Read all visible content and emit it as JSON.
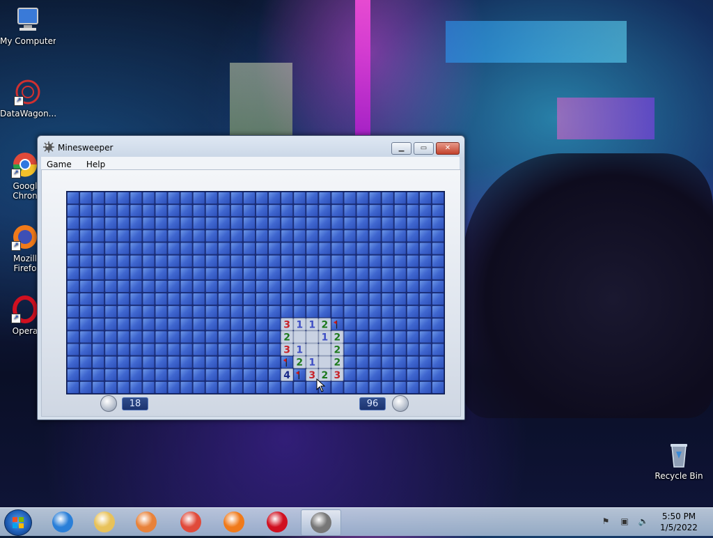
{
  "desktop": {
    "icons": [
      {
        "label": "My Computer",
        "icon": "computer-icon"
      },
      {
        "label": "DataWagon...",
        "icon": "datawagon-icon"
      },
      {
        "label": "Googl Chron",
        "icon": "chrome-icon"
      },
      {
        "label": "Mozill Firefo",
        "icon": "firefox-icon"
      },
      {
        "label": "Opera",
        "icon": "opera-icon"
      },
      {
        "label": "Recycle Bin",
        "icon": "recycle-bin-icon"
      }
    ]
  },
  "window": {
    "title": "Minesweeper",
    "buttons": {
      "minimize": "▁",
      "maximize": "▭",
      "close": "✕"
    },
    "menu": [
      "Game",
      "Help"
    ]
  },
  "game": {
    "cols": 30,
    "rows": 16,
    "time": "18",
    "mines_remaining": "96",
    "revealed": [
      {
        "r": 10,
        "c": 17,
        "v": "3"
      },
      {
        "r": 10,
        "c": 18,
        "v": "1"
      },
      {
        "r": 10,
        "c": 19,
        "v": "1"
      },
      {
        "r": 10,
        "c": 20,
        "v": "2"
      },
      {
        "r": 10,
        "c": 21,
        "v": "F"
      },
      {
        "r": 11,
        "c": 17,
        "v": "2"
      },
      {
        "r": 11,
        "c": 18,
        "v": ""
      },
      {
        "r": 11,
        "c": 19,
        "v": ""
      },
      {
        "r": 11,
        "c": 20,
        "v": "1"
      },
      {
        "r": 11,
        "c": 21,
        "v": "2"
      },
      {
        "r": 12,
        "c": 17,
        "v": "3"
      },
      {
        "r": 12,
        "c": 18,
        "v": "1"
      },
      {
        "r": 12,
        "c": 19,
        "v": ""
      },
      {
        "r": 12,
        "c": 20,
        "v": ""
      },
      {
        "r": 12,
        "c": 21,
        "v": "2"
      },
      {
        "r": 13,
        "c": 17,
        "v": "F"
      },
      {
        "r": 13,
        "c": 18,
        "v": "2"
      },
      {
        "r": 13,
        "c": 19,
        "v": "1"
      },
      {
        "r": 13,
        "c": 20,
        "v": ""
      },
      {
        "r": 13,
        "c": 21,
        "v": "2"
      },
      {
        "r": 14,
        "c": 17,
        "v": "4"
      },
      {
        "r": 14,
        "c": 18,
        "v": "F"
      },
      {
        "r": 14,
        "c": 19,
        "v": "3"
      },
      {
        "r": 14,
        "c": 20,
        "v": "2"
      },
      {
        "r": 14,
        "c": 21,
        "v": "3"
      }
    ],
    "number_colors": {
      "1": "#3f4fc4",
      "2": "#1f7a1f",
      "3": "#c8242a",
      "4": "#1a2a8a",
      "F": "#d01818"
    }
  },
  "taskbar": {
    "apps": [
      {
        "name": "internet-explorer-icon",
        "color": "#2a7fd8"
      },
      {
        "name": "file-explorer-icon",
        "color": "#e8c25a"
      },
      {
        "name": "media-player-icon",
        "color": "#e8823a"
      },
      {
        "name": "chrome-icon",
        "color": "#e04a3a"
      },
      {
        "name": "firefox-icon",
        "color": "#f07a1a"
      },
      {
        "name": "opera-icon",
        "color": "#d01020"
      },
      {
        "name": "minesweeper-icon",
        "color": "#777777"
      }
    ],
    "clock_time": "5:50 PM",
    "clock_date": "1/5/2022"
  }
}
